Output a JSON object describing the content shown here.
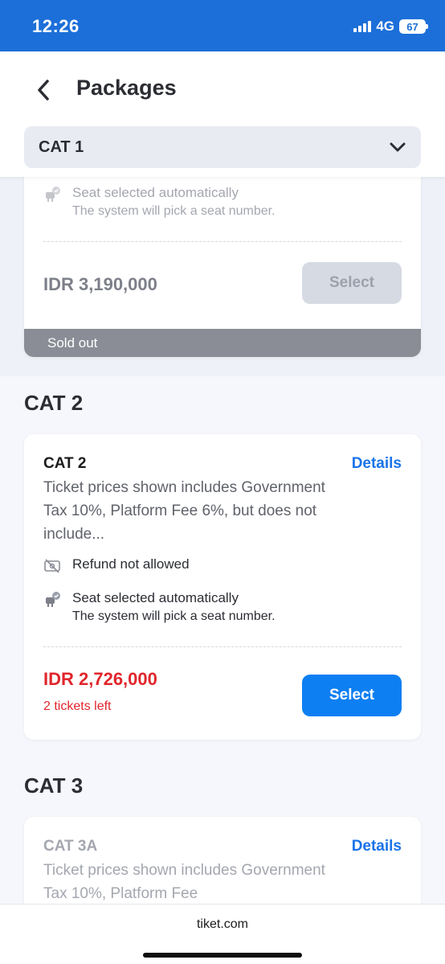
{
  "status_bar": {
    "time": "12:26",
    "network": "4G",
    "battery": "67"
  },
  "header": {
    "title": "Packages",
    "dropdown_value": "CAT 1"
  },
  "cat1_card": {
    "seat_title": "Seat selected automatically",
    "seat_subtitle": "The system will pick a seat number.",
    "price": "IDR 3,190,000",
    "button": "Select",
    "sold_out": "Sold out"
  },
  "cat2": {
    "section_title": "CAT 2",
    "card": {
      "name": "CAT 2",
      "details": "Details",
      "description": "Ticket prices shown includes Government Tax 10%, Platform Fee 6%, but does not include...",
      "refund": "Refund not allowed",
      "seat_title": "Seat selected automatically",
      "seat_subtitle": "The system will pick a seat number.",
      "price": "IDR 2,726,000",
      "tickets_left": "2 tickets left",
      "button": "Select"
    }
  },
  "cat3": {
    "section_title": "CAT 3",
    "card": {
      "name": "CAT 3A",
      "details": "Details",
      "description": "Ticket prices shown includes Government Tax 10%, Platform Fee"
    }
  },
  "footer": {
    "url": "tiket.com"
  },
  "colors": {
    "brand_blue": "#1c6fd9",
    "link_blue": "#1a73e8",
    "price_red": "#e0262c",
    "sold_out_gray": "#8a8d96"
  }
}
